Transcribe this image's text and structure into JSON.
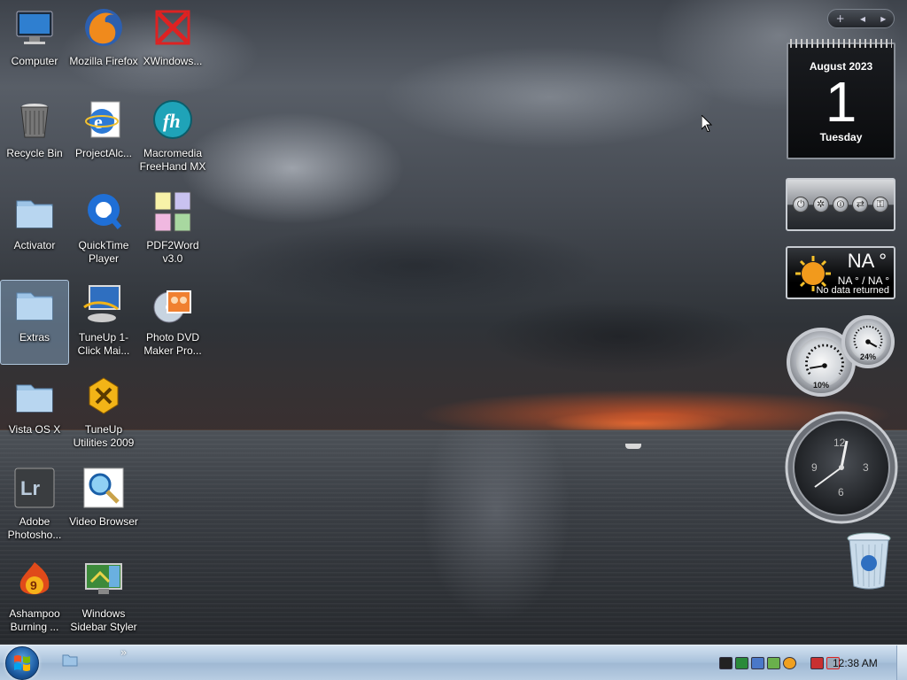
{
  "desktop": {
    "icons": [
      {
        "label": "Computer"
      },
      {
        "label": "Mozilla Firefox"
      },
      {
        "label": "XWindows..."
      },
      {
        "label": "Recycle Bin"
      },
      {
        "label": "ProjectAlc..."
      },
      {
        "label": "Macromedia FreeHand MX"
      },
      {
        "label": "Activator"
      },
      {
        "label": "QuickTime Player"
      },
      {
        "label": "PDF2Word v3.0"
      },
      {
        "label": "Extras",
        "selected": true
      },
      {
        "label": "TuneUp 1-Click Mai..."
      },
      {
        "label": "Photo DVD Maker Pro..."
      },
      {
        "label": "Vista OS X"
      },
      {
        "label": "TuneUp Utilities 2009"
      },
      {
        "label": "Adobe Photosho..."
      },
      {
        "label": "Video Browser"
      },
      {
        "label": "Ashampoo Burning ..."
      },
      {
        "label": "Windows Sidebar Styler"
      }
    ]
  },
  "sidebar": {
    "toolbar": {
      "add": "+",
      "prev": "◂",
      "next": "▸"
    },
    "calendar": {
      "month_year": "August 2023",
      "day": "1",
      "weekday": "Tuesday"
    },
    "weather": {
      "temperature": "NA °",
      "range": "NA ° / NA °",
      "status": "No data returned"
    },
    "cpu_meter": {
      "value": "10%"
    },
    "memory_meter": {
      "value": "24%"
    },
    "clock": {
      "numbers": [
        "12",
        "3",
        "6",
        "9"
      ]
    }
  },
  "taskbar": {
    "quick_launch_more": "»",
    "clock": "12:38 AM"
  },
  "colors": {
    "taskbar_top": "#d3e2f1",
    "taskbar_bottom": "#9fb8d3",
    "sunset": "#d65628"
  }
}
